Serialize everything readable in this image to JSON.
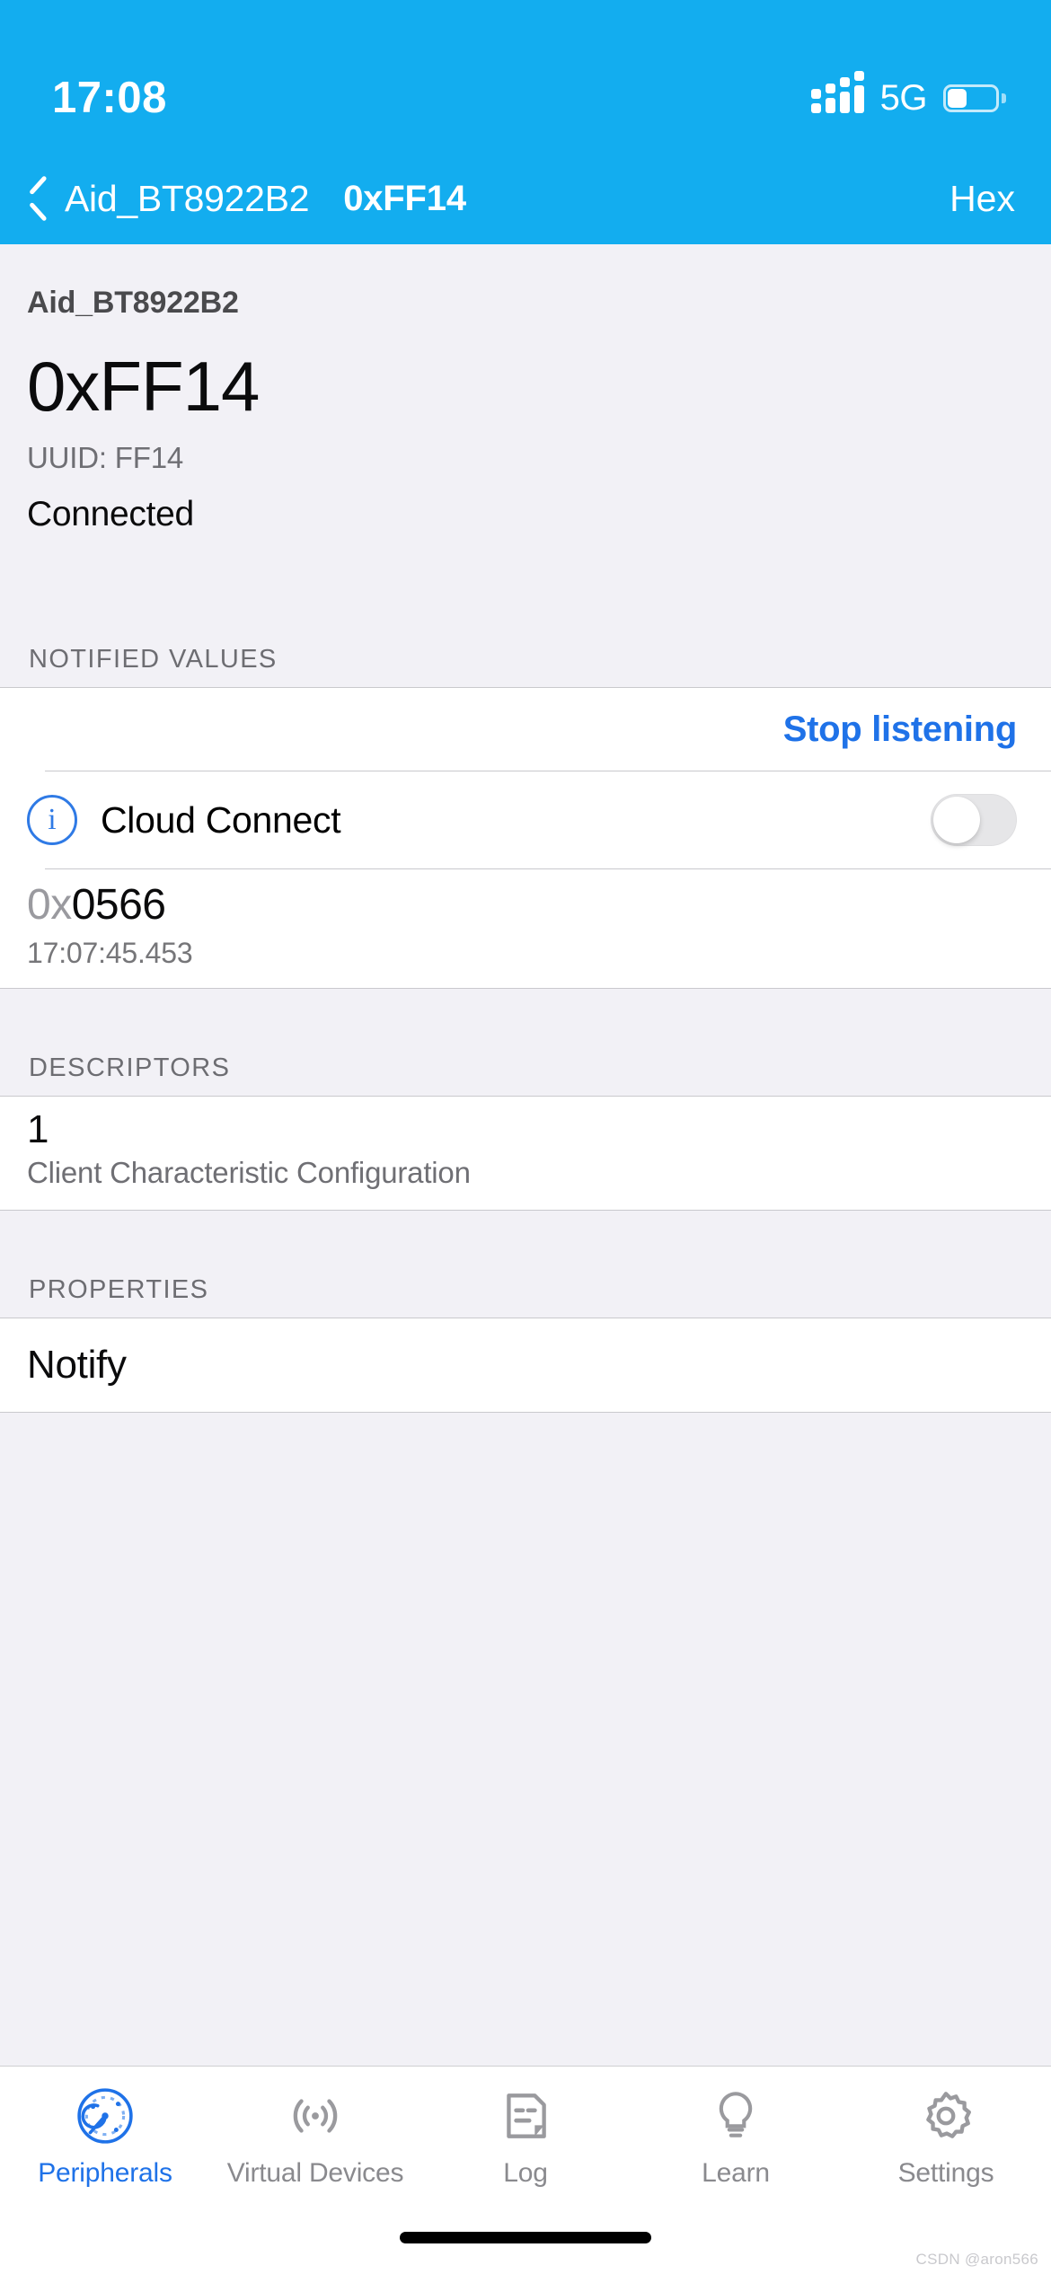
{
  "status_bar": {
    "time": "17:08",
    "network": "5G",
    "signal_icon": "cellular-signal-icon",
    "battery_icon": "battery-icon",
    "battery_level_pct": 34
  },
  "nav_bar": {
    "back_icon": "chevron-left-icon",
    "back_label": "Aid_BT8922B2",
    "title": "0xFF14",
    "right_action": "Hex",
    "background_color": "#13ADEF"
  },
  "header": {
    "device_name": "Aid_BT8922B2",
    "characteristic": "0xFF14",
    "uuid": "UUID: FF14",
    "connection_state": "Connected"
  },
  "notified_values": {
    "section_title": "NOTIFIED VALUES",
    "action_label": "Stop listening",
    "action_color": "#1f72e8",
    "toggle_row": {
      "info_icon": "info-circle-icon",
      "label": "Cloud Connect",
      "toggle_state": "off"
    },
    "value": {
      "prefix": "0x",
      "hex": "0566",
      "timestamp": "17:07:45.453"
    }
  },
  "descriptors": {
    "section_title": "DESCRIPTORS",
    "items": [
      {
        "number": "1",
        "name": "Client Characteristic Configuration"
      }
    ]
  },
  "properties": {
    "section_title": "PROPERTIES",
    "items": [
      "Notify"
    ]
  },
  "tab_bar": {
    "tabs": [
      {
        "label": "Peripherals",
        "icon": "radar-scan-icon",
        "active": true
      },
      {
        "label": "Virtual Devices",
        "icon": "broadcast-icon",
        "active": false
      },
      {
        "label": "Log",
        "icon": "document-lines-icon",
        "active": false
      },
      {
        "label": "Learn",
        "icon": "lightbulb-icon",
        "active": false
      },
      {
        "label": "Settings",
        "icon": "gear-icon",
        "active": false
      }
    ],
    "active_color": "#1f72e8",
    "inactive_color": "#8a8a8e"
  },
  "watermark": "CSDN @aron566"
}
